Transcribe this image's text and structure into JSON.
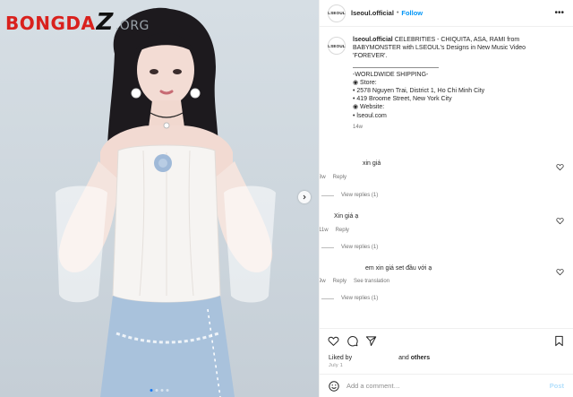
{
  "watermark": {
    "main": "BONGDA",
    "z": "Z",
    "suffix": ".ORG"
  },
  "post": {
    "avatar_text": "LSEOUL",
    "username": "lseoul.official",
    "separator": "•",
    "follow_label": "Follow",
    "more_label": "•••"
  },
  "caption": {
    "username": "lseoul.official",
    "title_line": "CELEBRITIES - CHIQUITA, ASA, RAMI from BABYMONSTER with LSEOUL's Designs in New Music Video 'FOREVER'.",
    "shipping": "-WORLDWIDE SHIPPING-",
    "store_label": "◉ Store:",
    "store_1": "• 2578 Nguyen Trai, District 1, Ho Chi Minh City",
    "store_2": "• 419 Broome Street, New York City",
    "website_label": "◉ Website:",
    "website": "• lseoul.com",
    "time": "14w"
  },
  "comments": [
    {
      "text": "xin giá",
      "time": "8w",
      "reply": "Reply",
      "translation": "",
      "replies": "View replies (1)"
    },
    {
      "text": "Xin giá ạ",
      "time": "11w",
      "reply": "Reply",
      "translation": "",
      "replies": "View replies (1)"
    },
    {
      "text": "em xin giá set đầu với ạ",
      "time": "9w",
      "reply": "Reply",
      "translation": "See translation",
      "replies": "View replies (1)"
    }
  ],
  "likes": {
    "prefix": "Liked by",
    "suffix": "and",
    "others": "others"
  },
  "date": "July 1",
  "add_comment": {
    "placeholder": "Add a comment…",
    "post_label": "Post"
  },
  "icons": [
    "heart-icon",
    "comment-icon",
    "share-icon",
    "bookmark-icon",
    "emoji-icon",
    "more-icon",
    "chevron-right-icon"
  ],
  "colors": {
    "accent": "#0095f6",
    "watermark_red": "#d9211d",
    "text": "#262626",
    "muted": "#737373"
  }
}
